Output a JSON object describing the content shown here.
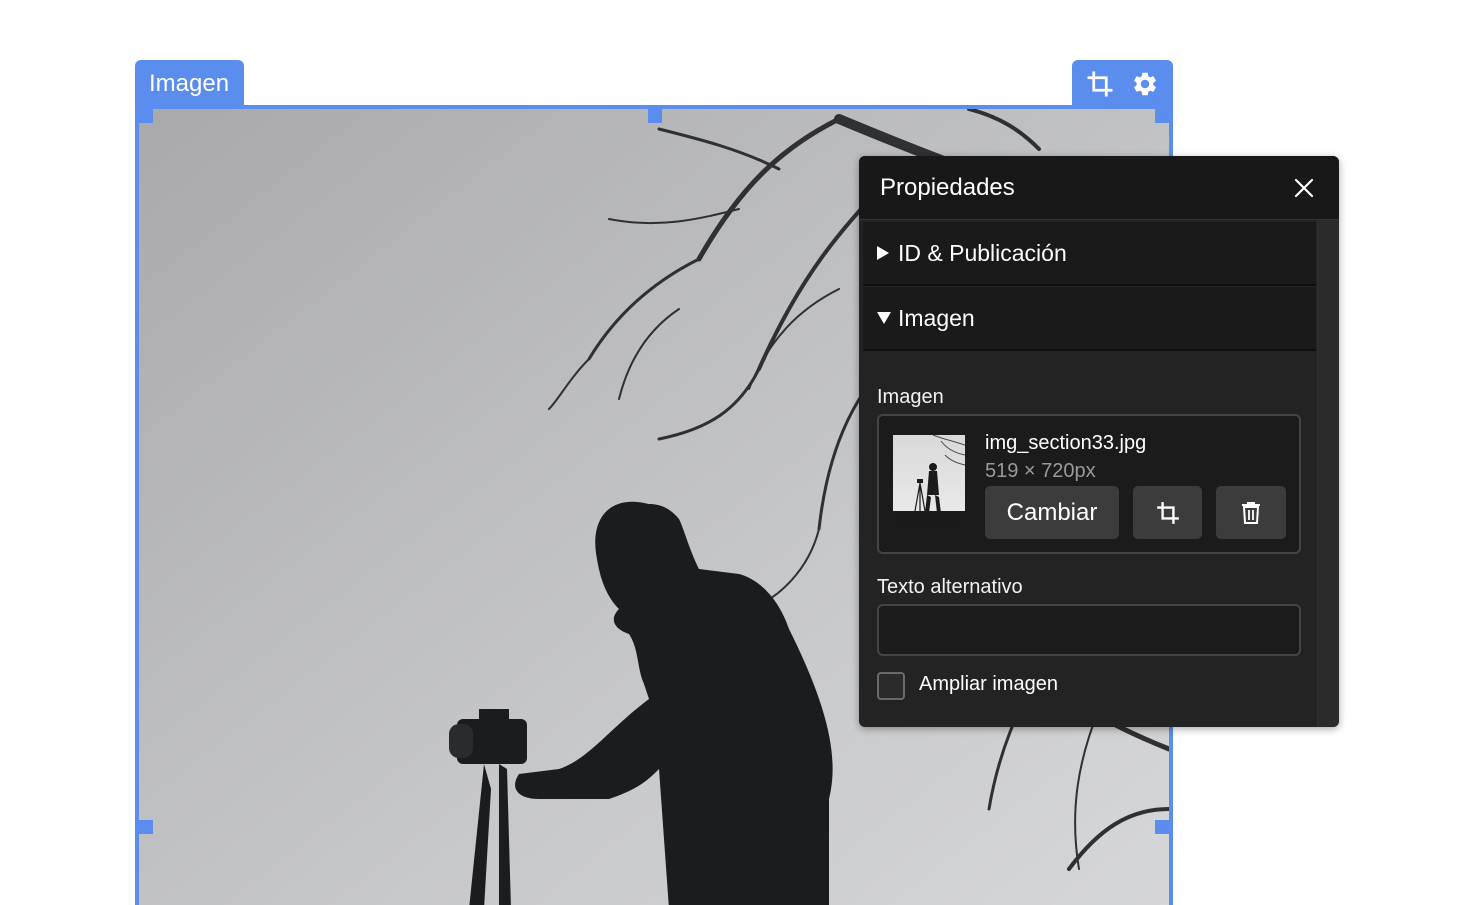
{
  "block": {
    "label": "Imagen",
    "tools": {
      "crop_icon": "crop-icon",
      "settings_icon": "gear-icon"
    }
  },
  "panel": {
    "title": "Propiedades",
    "close_icon": "close-icon",
    "sections": [
      {
        "label": "ID & Publicación",
        "expanded": false
      },
      {
        "label": "Imagen",
        "expanded": true
      }
    ],
    "image_field": {
      "label": "Imagen",
      "file_name": "img_section33.jpg",
      "dimensions": "519 × 720px",
      "change_label": "Cambiar",
      "crop_icon": "crop-icon",
      "delete_icon": "trash-icon"
    },
    "alt_text": {
      "label": "Texto alternativo",
      "value": ""
    },
    "enlarge": {
      "label": "Ampliar imagen",
      "checked": false
    }
  },
  "colors": {
    "accent": "#5b8def",
    "panel_bg": "#232323",
    "panel_header_bg": "#181818",
    "button_bg": "#3c3c3c"
  }
}
